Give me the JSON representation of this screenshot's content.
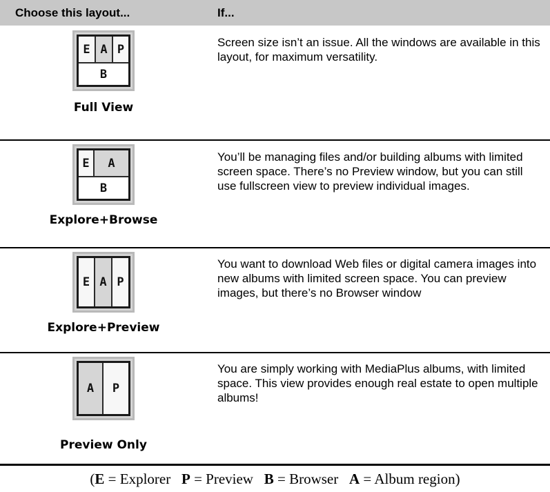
{
  "header": {
    "col1": "Choose this layout...",
    "col2": "If..."
  },
  "rows": [
    {
      "name": "Full View",
      "description": "Screen size isn’t an issue. All the windows are available in this layout, for maximum versatility.",
      "panes": [
        "E",
        "A",
        "P",
        "B"
      ]
    },
    {
      "name": "Explore+Browse",
      "description": "You’ll be managing files and/or building albums with limited screen space. There’s no Preview window, but you can still use fullscreen view to preview individual images.",
      "panes": [
        "E",
        "A",
        "B"
      ]
    },
    {
      "name": "Explore+Preview",
      "description": "You want to download Web files or digital camera images into new albums with limited screen space. You can preview images, but there’s no Browser window",
      "panes": [
        "E",
        "A",
        "P"
      ]
    },
    {
      "name": "Preview Only",
      "description": "You are simply working with MediaPlus albums, with limited space. This view provides enough real estate to open multiple albums!",
      "panes": [
        "A",
        "P"
      ]
    }
  ],
  "legend": {
    "open": "(",
    "e_key": "E",
    "e_val": " = Explorer   ",
    "p_key": "P",
    "p_val": " = Preview   ",
    "b_key": "B",
    "b_val": " = Browser   ",
    "a_key": "A",
    "a_val": " = Album region)"
  }
}
